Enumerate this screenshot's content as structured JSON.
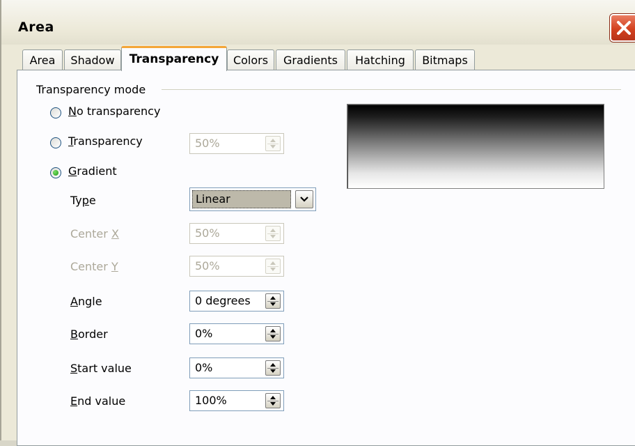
{
  "window": {
    "title": "Area"
  },
  "tabs": [
    {
      "label": "Area",
      "active": false
    },
    {
      "label": "Shadow",
      "active": false
    },
    {
      "label": "Transparency",
      "active": true
    },
    {
      "label": "Colors",
      "active": false
    },
    {
      "label": "Gradients",
      "active": false
    },
    {
      "label": "Hatching",
      "active": false
    },
    {
      "label": "Bitmaps",
      "active": false
    }
  ],
  "mode": {
    "group_label": "Transparency mode",
    "options": [
      {
        "label": "No transparency",
        "mnemonic": "N",
        "checked": false
      },
      {
        "label": "Transparency",
        "mnemonic": "T",
        "checked": false
      },
      {
        "label": "Gradient",
        "mnemonic": "G",
        "checked": true
      }
    ],
    "transparency_value": "50%"
  },
  "gradient": {
    "type_label": "Type",
    "type_value": "Linear",
    "fields": [
      {
        "label": "Center X",
        "value": "50%",
        "enabled": false
      },
      {
        "label": "Center Y",
        "value": "50%",
        "enabled": false
      },
      {
        "label": "Angle",
        "value": "0 degrees",
        "enabled": true
      },
      {
        "label": "Border",
        "value": "0%",
        "enabled": true
      },
      {
        "label": "Start value",
        "value": "0%",
        "enabled": true
      },
      {
        "label": "End value",
        "value": "100%",
        "enabled": true
      }
    ]
  },
  "colors": {
    "active_tab_accent": "#f4a638",
    "close_button": "#d3411f",
    "selected_radio": "#1d9a16"
  }
}
